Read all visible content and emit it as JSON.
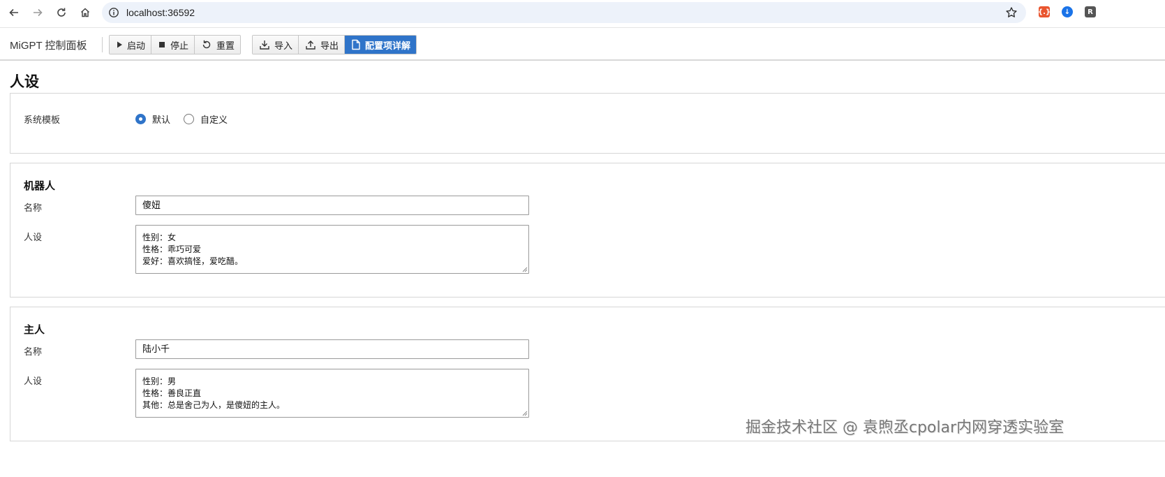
{
  "browser": {
    "url": "localhost:36592",
    "extensions": [
      {
        "name": "json-ext",
        "glyph": "{.}",
        "color": "#e9552f"
      },
      {
        "name": "download-ext",
        "glyph": "↓",
        "color": "#1a73e8"
      },
      {
        "name": "r-ext",
        "glyph": "R",
        "color": "#555555"
      }
    ]
  },
  "toolbar": {
    "app_title": "MiGPT 控制面板",
    "start_label": "启动",
    "stop_label": "停止",
    "reset_label": "重置",
    "import_label": "导入",
    "export_label": "导出",
    "config_doc_label": "配置项详解"
  },
  "page": {
    "heading": "人设"
  },
  "system_template": {
    "label": "系统模板",
    "options": [
      {
        "label": "默认",
        "checked": true
      },
      {
        "label": "自定义",
        "checked": false
      }
    ]
  },
  "bot": {
    "section_title": "机器人",
    "name_label": "名称",
    "name_value": "傻妞",
    "profile_label": "人设",
    "profile_lines": [
      "性别：女",
      "性格：乖巧可爱",
      "爱好：喜欢搞怪，爱吃醋。"
    ]
  },
  "master": {
    "section_title": "主人",
    "name_label": "名称",
    "name_value": "陆小千",
    "profile_label": "人设",
    "profile_lines": [
      "性别：男",
      "性格：善良正直",
      "其他：总是舍己为人，是傻妞的主人。"
    ]
  },
  "watermark": "掘金技术社区 @ 袁煦丞cpolar内网穿透实验室",
  "colors": {
    "primary": "#2f74c9",
    "address_bar": "#edf2fa"
  }
}
